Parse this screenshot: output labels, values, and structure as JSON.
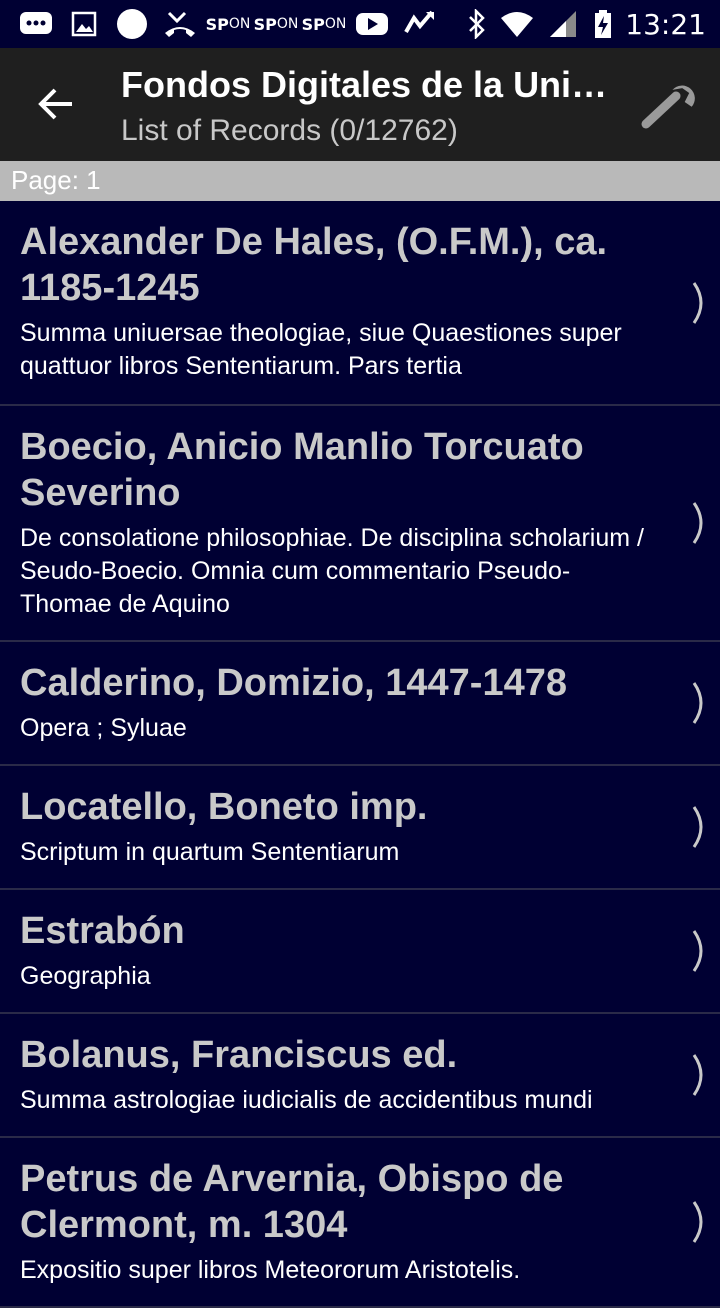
{
  "status_bar": {
    "time": "13:21",
    "sp_icons": [
      {
        "top": "SP",
        "bottom": "ON"
      },
      {
        "top": "SP",
        "bottom": "ON"
      },
      {
        "top": "SP",
        "bottom": "ON"
      }
    ]
  },
  "app_bar": {
    "title": "Fondos Digitales de la Universidad",
    "subtitle": "List of Records (0/12762)"
  },
  "page_bar": {
    "label": "Page: 1"
  },
  "records": [
    {
      "author": "Alexander De Hales, (O.F.M.), ca. 1185-1245",
      "title": "Summa uniuersae theologiae, siue Quaestiones super quattuor libros Sententiarum. Pars tertia"
    },
    {
      "author": "Boecio, Anicio Manlio Torcuato Severino",
      "title": "De consolatione philosophiae. De disciplina scholarium / Seudo-Boecio. Omnia cum commentario Pseudo-Thomae de Aquino"
    },
    {
      "author": "Calderino, Domizio, 1447-1478",
      "title": "Opera ; Syluae"
    },
    {
      "author": "Locatello, Boneto imp.",
      "title": "Scriptum in quartum Sententiarum"
    },
    {
      "author": "Estrabón",
      "title": "Geographia"
    },
    {
      "author": "Bolanus, Franciscus ed.",
      "title": "Summa astrologiae iudicialis de accidentibus mundi"
    },
    {
      "author": "Petrus de Arvernia, Obispo de Clermont, m. 1304",
      "title": "Expositio super libros Meteororum Aristotelis."
    }
  ],
  "colors": {
    "background": "#000033",
    "app_bar": "#1f1f1f",
    "page_bar": "#b9b9b9",
    "item_title": "#c9c9c9"
  }
}
